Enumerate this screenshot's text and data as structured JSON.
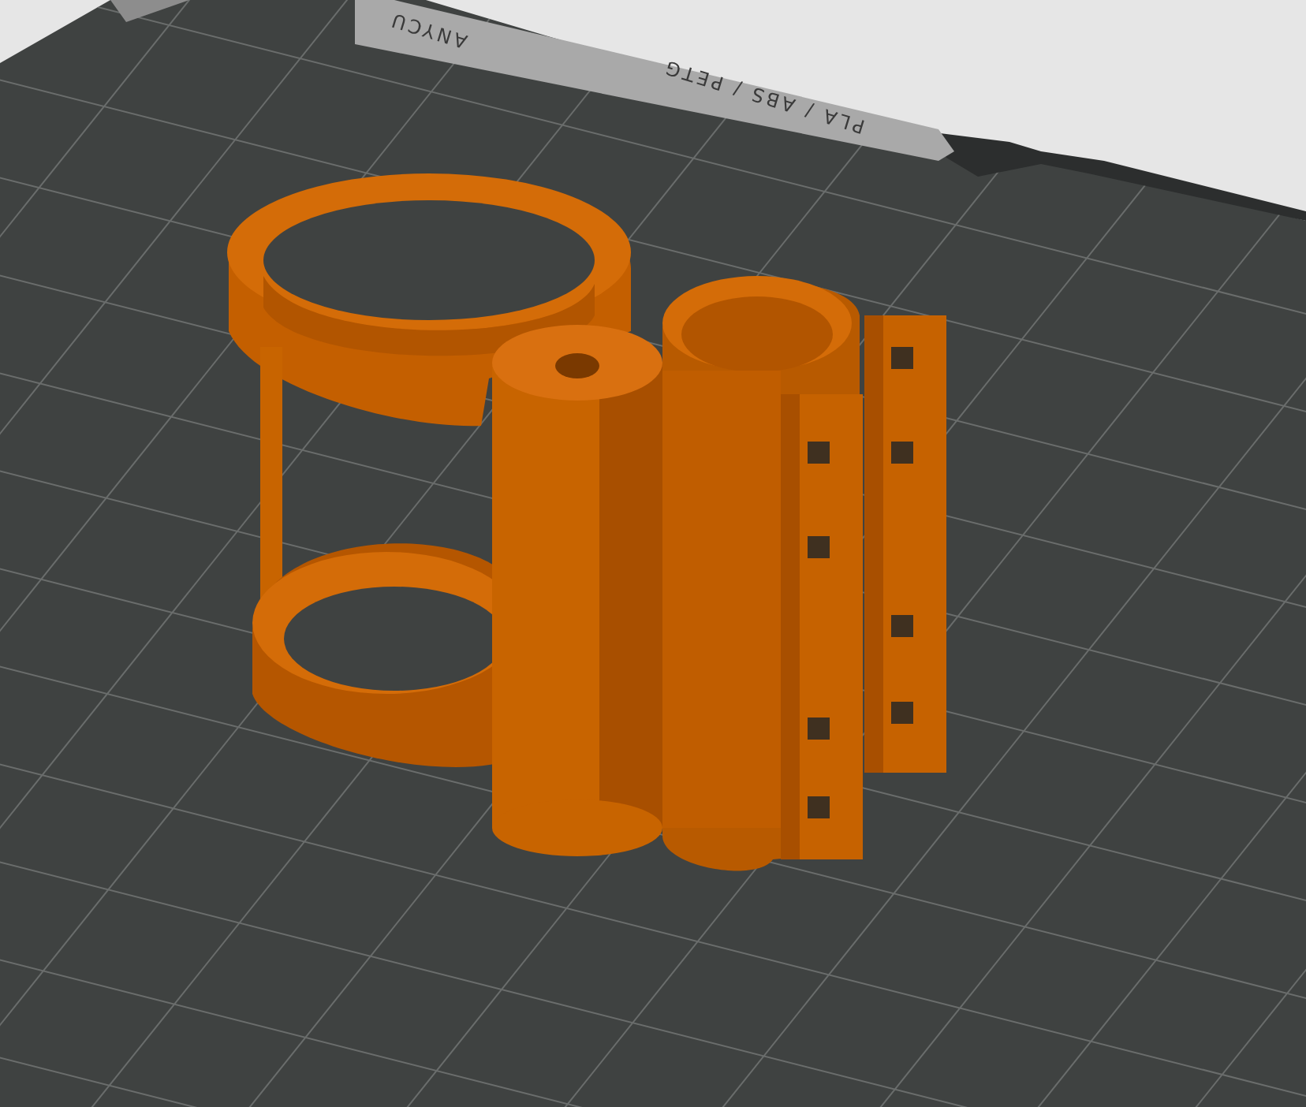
{
  "build_plate": {
    "labels": [
      "ANYCU",
      "PLA / ABS / PETG"
    ]
  }
}
